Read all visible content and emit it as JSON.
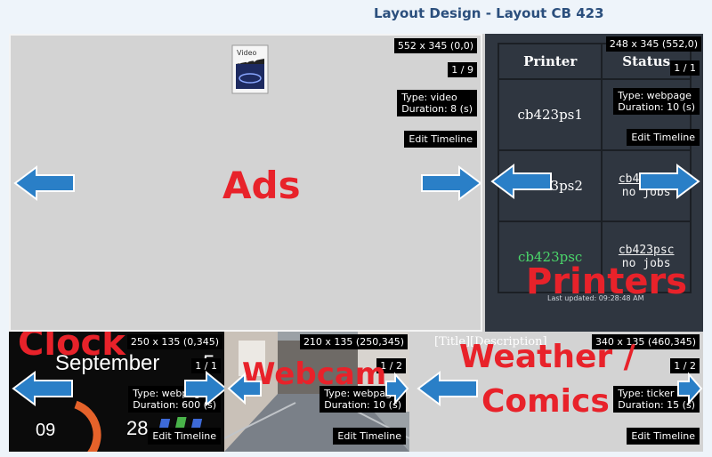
{
  "page": {
    "title": "Layout Design - Layout CB 423"
  },
  "regions": {
    "ads": {
      "size": "552 x 345 (0,0)",
      "index": "1 / 9",
      "type": "Type: video",
      "duration": "Duration: 8 (s)",
      "edit": "Edit Timeline",
      "label": "Ads",
      "icon_caption": "Video"
    },
    "printers": {
      "size": "248 x 345 (552,0)",
      "index": "1 / 1",
      "type": "Type: webpage",
      "duration": "Duration: 10 (s)",
      "edit": "Edit Timeline",
      "label": "Printers",
      "table": {
        "headers": [
          "Printer",
          "Status"
        ],
        "rows": [
          {
            "printer": "cb423ps1",
            "status_name": "",
            "status_text": ""
          },
          {
            "printer": "cb423ps2",
            "status_name": "cb423ps2",
            "status_text": "no jobs"
          },
          {
            "printer": "cb423psc",
            "status_name": "cb423psc",
            "status_text": "no jobs"
          }
        ],
        "last_updated": "Last updated: 09:28:48 AM"
      }
    },
    "clock": {
      "size": "250 x 135 (0,345)",
      "index": "1 / 1",
      "type": "Type: webpage",
      "duration": "Duration: 600 (s)",
      "edit": "Edit Timeline",
      "label": "Clock",
      "month": "September",
      "day_digit": "5",
      "hour": "09",
      "minute": "28"
    },
    "webcam": {
      "size": "210 x 135 (250,345)",
      "index": "1 / 2",
      "type": "Type: webpage",
      "duration": "Duration: 10 (s)",
      "edit": "Edit Timeline",
      "label": "Webcam"
    },
    "weather": {
      "size": "340 x 135 (460,345)",
      "index": "1 / 2",
      "type": "Type: ticker",
      "duration": "Duration: 15 (s)",
      "edit": "Edit Timeline",
      "label_line1": "Weather /",
      "label_line2": "Comics",
      "placeholder": "[Title][Description]"
    }
  },
  "colors": {
    "arrow": "#2a7fc7",
    "label": "#e8222a"
  },
  "icons": {
    "left": "arrow-left-icon",
    "right": "arrow-right-icon",
    "video": "video-file-icon"
  }
}
